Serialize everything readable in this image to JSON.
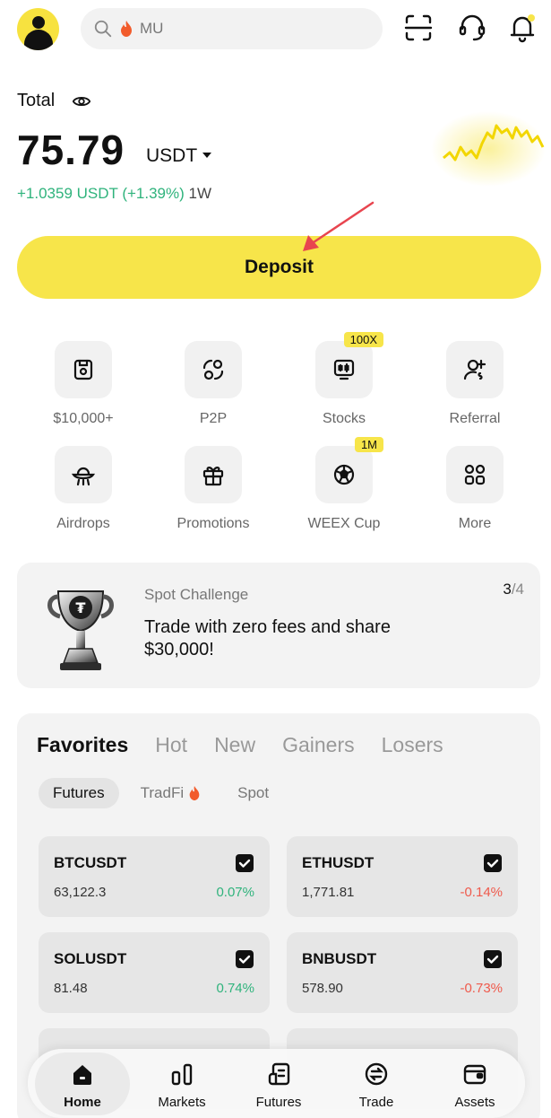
{
  "header": {
    "search_term": "MU",
    "icons": [
      "avatar",
      "search-icon",
      "flame-icon",
      "scan-icon",
      "support-icon",
      "bell-icon"
    ]
  },
  "balance": {
    "label": "Total",
    "value": "75.79",
    "unit": "USDT",
    "change": "+1.0359 USDT (+1.39%)",
    "period": "1W"
  },
  "deposit_label": "Deposit",
  "features": [
    {
      "label": "$10,000+",
      "icon": "wallet-icon",
      "badge": ""
    },
    {
      "label": "P2P",
      "icon": "p2p-icon",
      "badge": ""
    },
    {
      "label": "Stocks",
      "icon": "stocks-icon",
      "badge": "100X"
    },
    {
      "label": "Referral",
      "icon": "referral-icon",
      "badge": ""
    },
    {
      "label": "Airdrops",
      "icon": "airdrop-icon",
      "badge": ""
    },
    {
      "label": "Promotions",
      "icon": "gift-icon",
      "badge": ""
    },
    {
      "label": "WEEX Cup",
      "icon": "soccer-ball-icon",
      "badge": "1M"
    },
    {
      "label": "More",
      "icon": "grid-icon",
      "badge": ""
    }
  ],
  "challenge": {
    "kicker": "Spot Challenge",
    "title": "Trade with zero fees and share $30,000!",
    "page_current": "3",
    "page_total": "/4"
  },
  "markets": {
    "tabs": [
      "Favorites",
      "Hot",
      "New",
      "Gainers",
      "Losers"
    ],
    "active_tab": "Favorites",
    "subtabs": [
      "Futures",
      "TradFi",
      "Spot"
    ],
    "active_subtab": "Futures",
    "items": [
      {
        "symbol": "BTCUSDT",
        "price": "63,122.3",
        "change": "0.07%",
        "direction": "up"
      },
      {
        "symbol": "ETHUSDT",
        "price": "1,771.81",
        "change": "-0.14%",
        "direction": "down"
      },
      {
        "symbol": "SOLUSDT",
        "price": "81.48",
        "change": "0.74%",
        "direction": "up"
      },
      {
        "symbol": "BNBUSDT",
        "price": "578.90",
        "change": "-0.73%",
        "direction": "down"
      }
    ]
  },
  "nav": [
    {
      "label": "Home",
      "icon": "home-icon"
    },
    {
      "label": "Markets",
      "icon": "markets-icon"
    },
    {
      "label": "Futures",
      "icon": "futures-icon"
    },
    {
      "label": "Trade",
      "icon": "trade-icon"
    },
    {
      "label": "Assets",
      "icon": "wallet-icon"
    }
  ],
  "colors": {
    "accent": "#f7e54a",
    "positive": "#2fb37c",
    "negative": "#ef5a4c",
    "annotation_arrow": "#e8454f"
  }
}
